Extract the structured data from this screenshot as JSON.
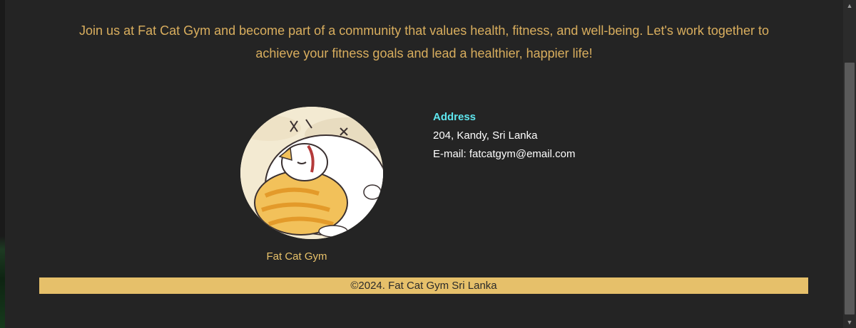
{
  "intro": {
    "text": "Join us at Fat Cat Gym and become part of a community that values health, fitness, and well-being. Let's work together to achieve your fitness goals and lead a healthier, happier life!"
  },
  "logo": {
    "icon": "fat-cat-illustration",
    "caption": "Fat Cat Gym"
  },
  "contact": {
    "heading": "Address",
    "address": "204, Kandy, Sri Lanka",
    "email": "E-mail: fatcatgym@email.com"
  },
  "footer": {
    "copyright": "©2024. Fat Cat Gym Sri Lanka"
  },
  "colors": {
    "page_bg": "#242424",
    "intro_text": "#d9ae5e",
    "heading": "#5ee7ef",
    "footer_bar": "#e6c06a"
  }
}
